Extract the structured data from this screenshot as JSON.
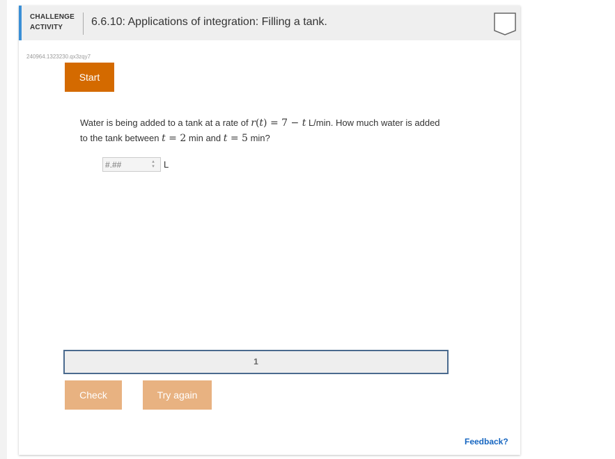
{
  "header": {
    "label_line1": "CHALLENGE",
    "label_line2": "ACTIVITY",
    "title": "6.6.10: Applications of integration: Filling a tank.",
    "completion_icon": "empty-checkbox-icon"
  },
  "activity_id": "240964.1323230.qx3zqy7",
  "start_label": "Start",
  "question": {
    "part1": "Water is being added to a tank at a rate of ",
    "rate_func": "r",
    "rate_var": "t",
    "rate_eq_mid": ") = 7 − ",
    "rate_var2": "t",
    "part2": " L/min. How much water is added to the tank between ",
    "t1_var": "t",
    "t1_eq": " = 2",
    "part3": " min and ",
    "t2_var": "t",
    "t2_eq": " = 5",
    "part4": " min?"
  },
  "answer": {
    "value": "",
    "placeholder": "#.##",
    "unit": "L",
    "spinner_icon": "spinner-arrows-icon"
  },
  "progress": {
    "current_level": "1"
  },
  "buttons": {
    "check": "Check",
    "try_again": "Try again"
  },
  "feedback_label": "Feedback?",
  "colors": {
    "accent": "#3a8fd6",
    "start_button": "#d46a00",
    "disabled_button": "#e8b281",
    "progress_border": "#4a6a8e",
    "link": "#1565c0"
  }
}
